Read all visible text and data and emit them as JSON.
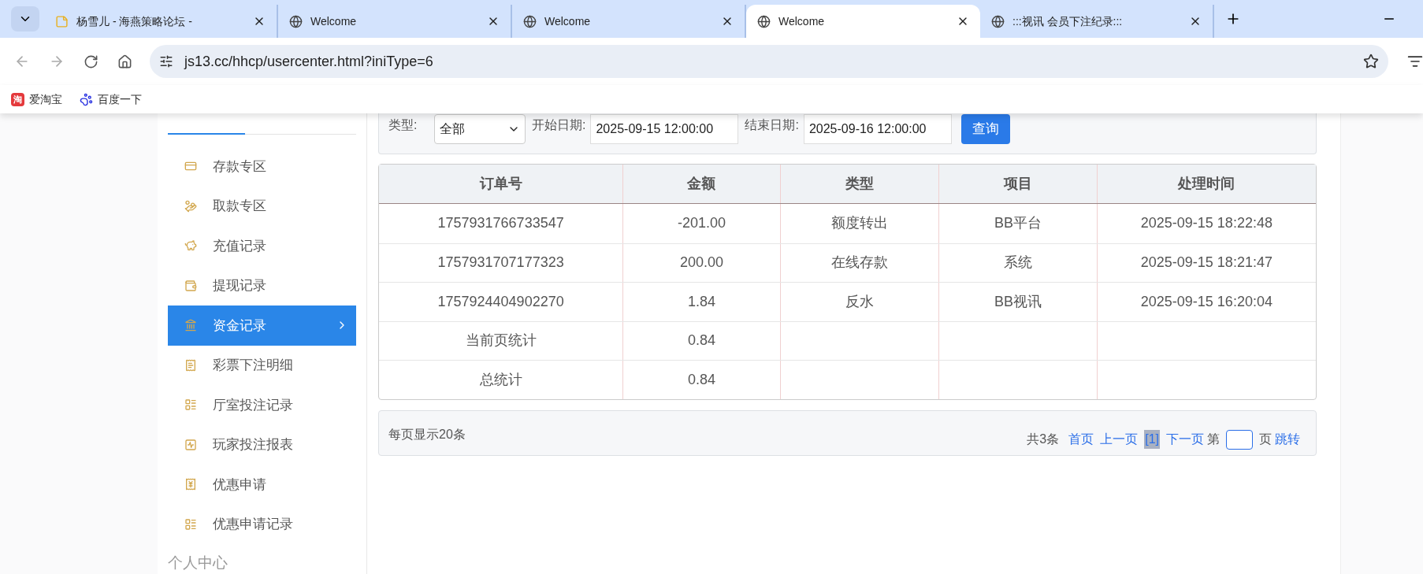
{
  "browser": {
    "tabs": [
      {
        "title": "杨雪儿 - 海燕策略论坛 -",
        "kind": "note",
        "selected": false
      },
      {
        "title": "Welcome",
        "kind": "globe",
        "selected": false
      },
      {
        "title": "Welcome",
        "kind": "globe",
        "selected": false
      },
      {
        "title": "Welcome",
        "kind": "globe",
        "selected": true
      },
      {
        "title": ":::视讯 会员下注纪录:::",
        "kind": "globe",
        "selected": false
      }
    ],
    "address": "js13.cc/hhcp/usercenter.html?iniType=6",
    "bookmarks": [
      {
        "icon_text": "淘",
        "label": "爱淘宝",
        "kind": "taobao"
      },
      {
        "label": "百度一下",
        "kind": "baidu"
      }
    ]
  },
  "sidebar": {
    "items": [
      {
        "label": "存款专区",
        "selected": false
      },
      {
        "label": "取款专区",
        "selected": false
      },
      {
        "label": "充值记录",
        "selected": false
      },
      {
        "label": "提现记录",
        "selected": false
      },
      {
        "label": "资金记录",
        "selected": true
      },
      {
        "label": "彩票下注明细",
        "selected": false
      },
      {
        "label": "厅室投注记录",
        "selected": false
      },
      {
        "label": "玩家投注报表",
        "selected": false
      },
      {
        "label": "优惠申请",
        "selected": false
      },
      {
        "label": "优惠申请记录",
        "selected": false
      }
    ],
    "section_title": "个人中心"
  },
  "filter": {
    "type_label": "类型:",
    "type_value": "全部",
    "start_label": "开始日期:",
    "start_value": "2025-09-15 12:00:00",
    "end_label": "结束日期:",
    "end_value": "2025-09-16 12:00:00",
    "query_button": "查询"
  },
  "table": {
    "columns": [
      "订单号",
      "金额",
      "类型",
      "项目",
      "处理时间"
    ],
    "rows": [
      [
        "1757931766733547",
        "-201.00",
        "额度转出",
        "BB平台",
        "2025-09-15 18:22:48"
      ],
      [
        "1757931707177323",
        "200.00",
        "在线存款",
        "系统",
        "2025-09-15 18:21:47"
      ],
      [
        "1757924404902270",
        "1.84",
        "反水",
        "BB视讯",
        "2025-09-15 16:20:04"
      ],
      [
        "当前页统计",
        "0.84",
        "",
        "",
        ""
      ],
      [
        "总统计",
        "0.84",
        "",
        "",
        ""
      ]
    ]
  },
  "pagination": {
    "per_page": "每页显示20条",
    "total": "共3条",
    "first": "首页",
    "prev": "上一页",
    "current": "[1]",
    "next": "下一页",
    "page_prefix": "第",
    "page_suffix": "页",
    "jump": "跳转"
  }
}
